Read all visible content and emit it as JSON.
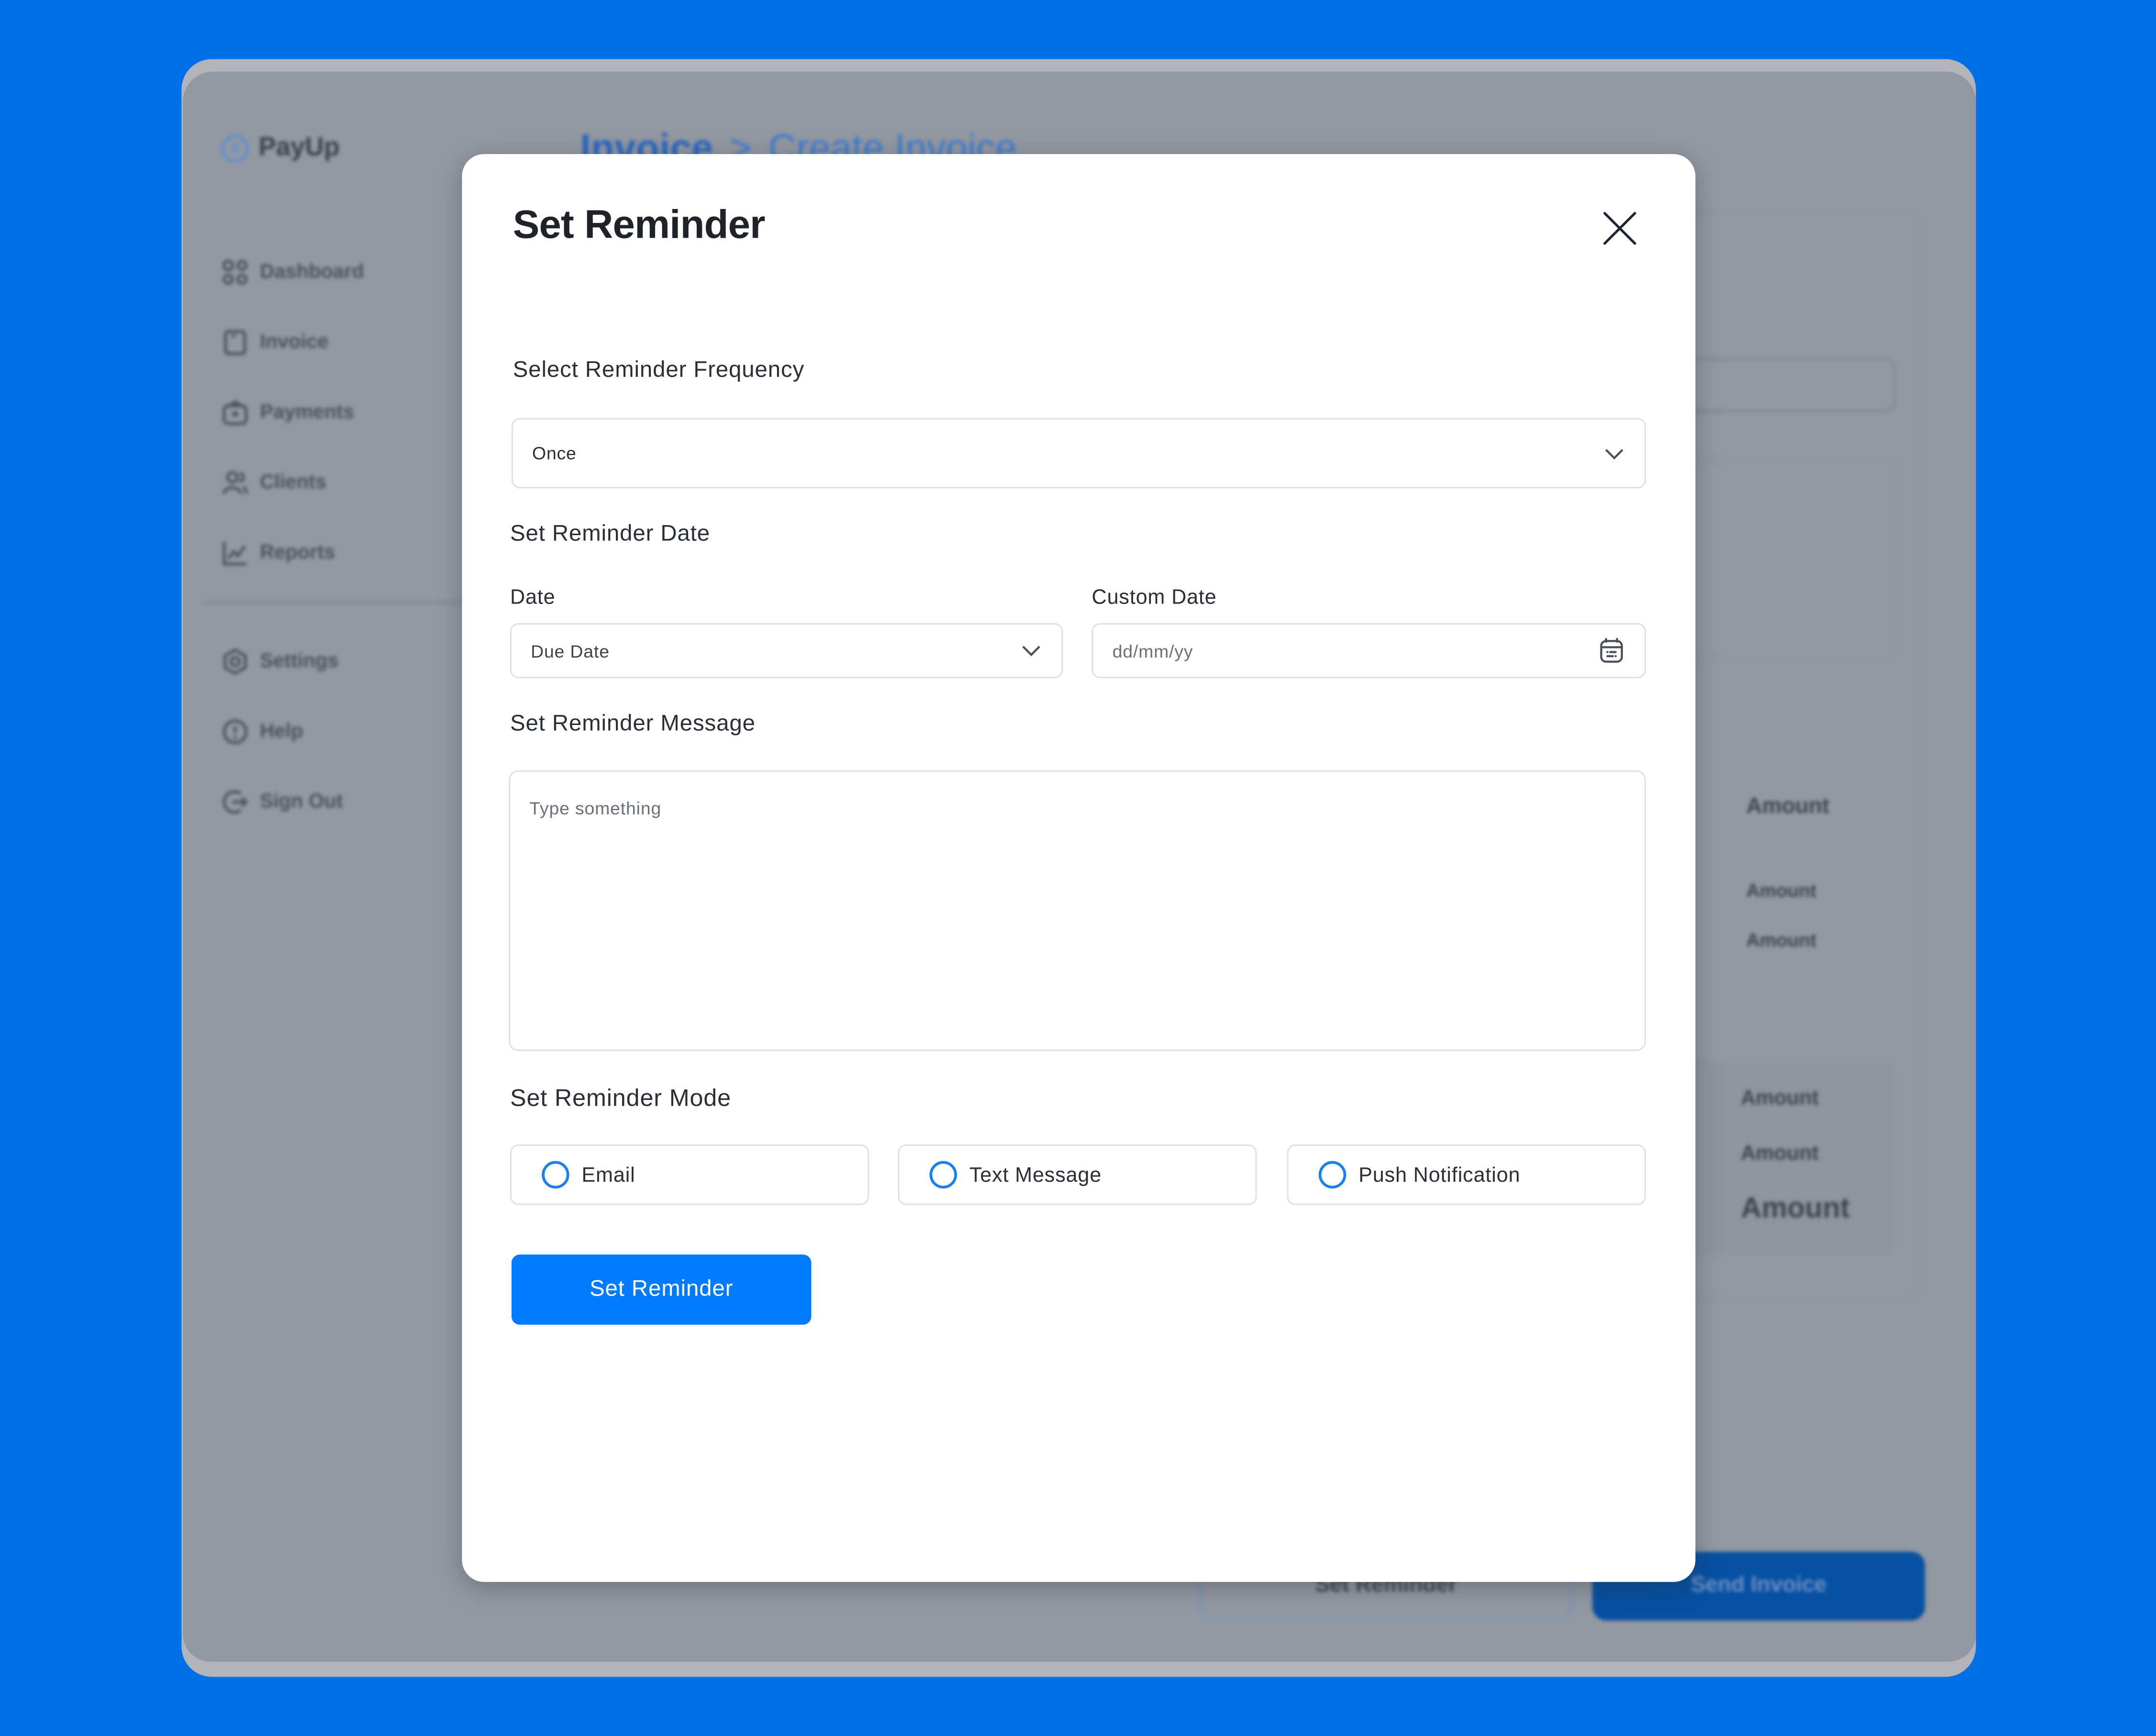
{
  "app": {
    "brand_name": "PayUp",
    "brand_color": "#3C7BD1",
    "background_color": "#0070E6"
  },
  "sidebar": {
    "items": [
      {
        "label": "Dashboard",
        "icon": "dashboard-grid-icon"
      },
      {
        "label": "Invoice",
        "icon": "invoice-document-icon"
      },
      {
        "label": "Payments",
        "icon": "payments-wallet-icon"
      },
      {
        "label": "Clients",
        "icon": "clients-users-icon"
      },
      {
        "label": "Reports",
        "icon": "reports-chart-icon"
      }
    ],
    "secondary_items": [
      {
        "label": "Settings",
        "icon": "gear-icon"
      },
      {
        "label": "Help",
        "icon": "help-circle-icon"
      },
      {
        "label": "Sign Out",
        "icon": "sign-out-icon"
      }
    ]
  },
  "background_page": {
    "breadcrumb": [
      "Invoice",
      "Create Invoice"
    ],
    "breadcrumb_separator": ">",
    "amount_labels": [
      "Amount",
      "Amount",
      "Amount",
      "Amount",
      "Amount",
      "Amount"
    ],
    "buttons": {
      "set_reminder": "Set Reminder",
      "send_invoice": "Send Invoice"
    }
  },
  "modal": {
    "title": "Set Reminder",
    "close_icon": "close-icon",
    "frequency": {
      "label": "Select Reminder Frequency",
      "value": "Once"
    },
    "date_section": {
      "label": "Set Reminder Date",
      "date_label": "Date",
      "date_value": "Due Date",
      "custom_date_label": "Custom Date",
      "custom_date_placeholder": "dd/mm/yy"
    },
    "message": {
      "label": "Set Reminder Message",
      "placeholder": "Type something"
    },
    "mode": {
      "label": "Set Reminder Mode",
      "options": [
        {
          "label": "Email",
          "selected": false
        },
        {
          "label": "Text Message",
          "selected": false
        },
        {
          "label": "Push Notification",
          "selected": false
        }
      ]
    },
    "submit_label": "Set Reminder",
    "accent_color": "#007BFF"
  }
}
